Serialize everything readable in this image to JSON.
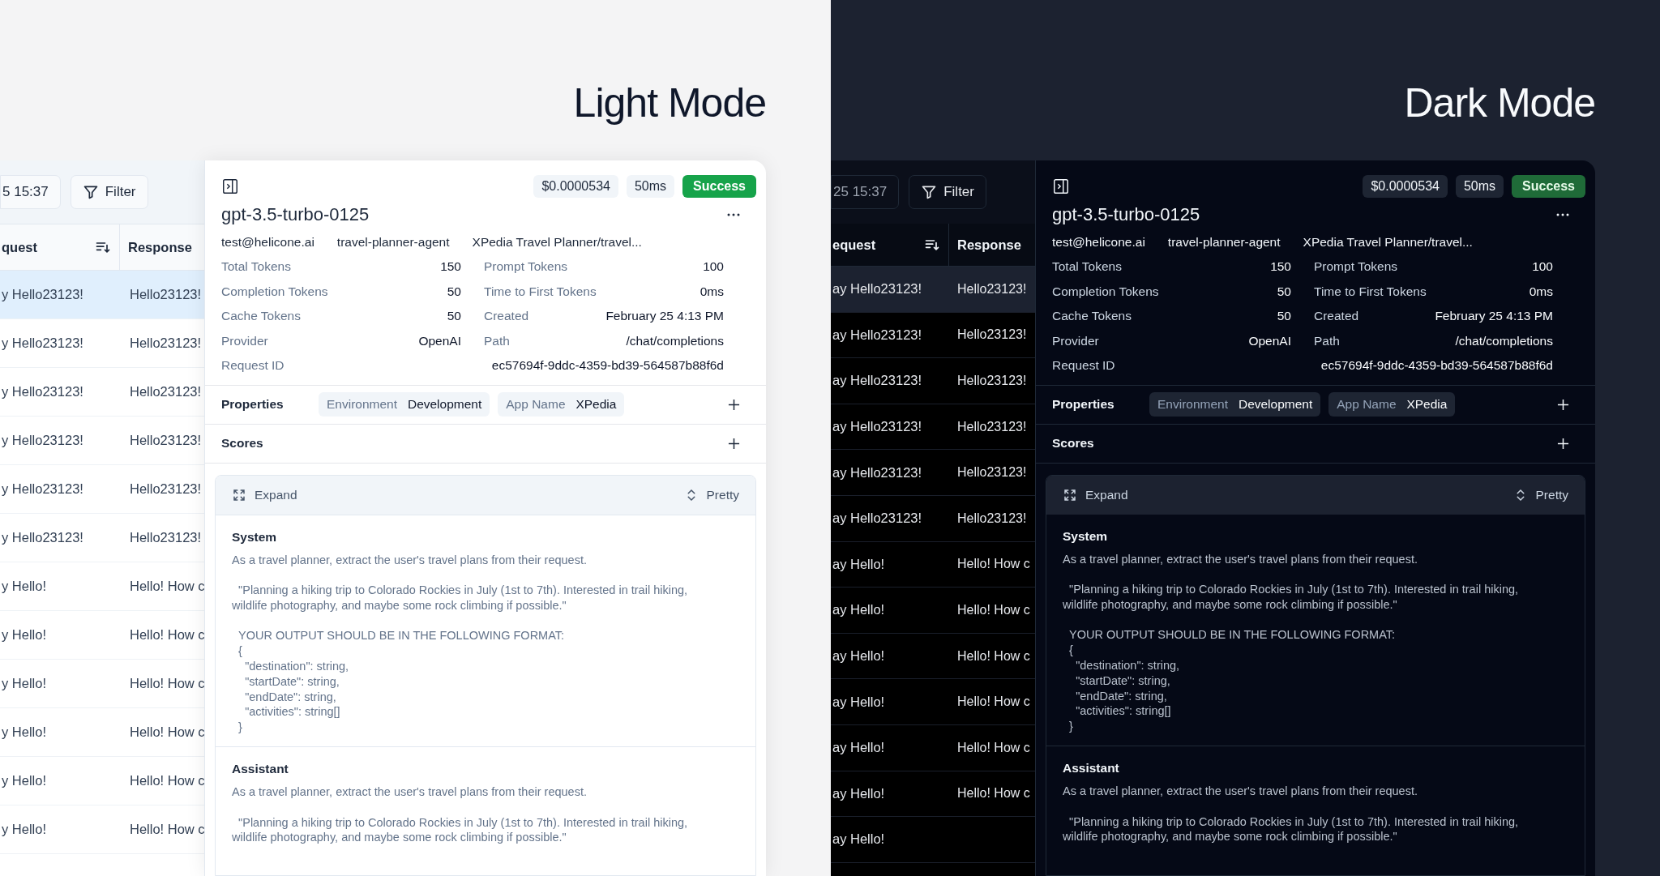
{
  "modes": [
    {
      "kind": "light",
      "heading": "Light Mode",
      "toolbar": {
        "date": "5 15:37",
        "filter": "Filter"
      },
      "table": {
        "columns": [
          "quest",
          "Response"
        ],
        "rows": [
          {
            "request": "y Hello23123!",
            "response": "Hello23123!",
            "selected": true
          },
          {
            "request": "y Hello23123!",
            "response": "Hello23123!",
            "selected": false
          },
          {
            "request": "y Hello23123!",
            "response": "Hello23123!",
            "selected": false
          },
          {
            "request": "y Hello23123!",
            "response": "Hello23123!",
            "selected": false
          },
          {
            "request": "y Hello23123!",
            "response": "Hello23123!",
            "selected": false
          },
          {
            "request": "y Hello23123!",
            "response": "Hello23123!",
            "selected": false
          },
          {
            "request": "y Hello!",
            "response": "Hello! How c",
            "selected": false
          },
          {
            "request": "y Hello!",
            "response": "Hello! How c",
            "selected": false
          },
          {
            "request": "y Hello!",
            "response": "Hello! How c",
            "selected": false
          },
          {
            "request": "y Hello!",
            "response": "Hello! How c",
            "selected": false
          },
          {
            "request": "y Hello!",
            "response": "Hello! How c",
            "selected": false
          },
          {
            "request": "y Hello!",
            "response": "Hello! How c",
            "selected": false
          }
        ]
      },
      "detail": {
        "cost": "$0.0000534",
        "latency": "50ms",
        "status": {
          "label": "Success",
          "kind": "success"
        },
        "model": "gpt-3.5-turbo-0125",
        "meta": [
          "test@helicone.ai",
          "travel-planner-agent",
          "XPedia Travel Planner/travel..."
        ],
        "stats": [
          {
            "label": "Total Tokens",
            "value": "150"
          },
          {
            "label": "Prompt Tokens",
            "value": "100"
          },
          {
            "label": "Completion Tokens",
            "value": "50"
          },
          {
            "label": "Time to First Tokens",
            "value": "0ms"
          },
          {
            "label": "Cache Tokens",
            "value": "50"
          },
          {
            "label": "Created",
            "value": "February 25 4:13 PM"
          },
          {
            "label": "Provider",
            "value": "OpenAI"
          },
          {
            "label": "Path",
            "value": "/chat/completions"
          }
        ],
        "request_id": {
          "label": "Request ID",
          "value": "ec57694f-9ddc-4359-bd39-564587b88f6d"
        },
        "properties": {
          "label": "Properties",
          "items": [
            {
              "key": "Environment",
              "value": "Development"
            },
            {
              "key": "App Name",
              "value": "XPedia"
            }
          ]
        },
        "scores": {
          "label": "Scores"
        },
        "viewer": {
          "expand": "Expand",
          "format": "Pretty",
          "messages": [
            {
              "role": "System",
              "text": "As a travel planner, extract the user's travel plans from their request.\n\n  \"Planning a hiking trip to Colorado Rockies in July (1st to 7th). Interested in trail hiking,\nwildlife photography, and maybe some rock climbing if possible.\"\n\n  YOUR OUTPUT SHOULD BE IN THE FOLLOWING FORMAT:\n  {\n    \"destination\": string,\n    \"startDate\": string,\n    \"endDate\": string,\n    \"activities\": string[]\n  }"
            },
            {
              "role": "Assistant",
              "text": "As a travel planner, extract the user's travel plans from their request.\n\n  \"Planning a hiking trip to Colorado Rockies in July (1st to 7th). Interested in trail hiking,\nwildlife photography, and maybe some rock climbing if possible.\""
            }
          ]
        }
      }
    },
    {
      "kind": "dark",
      "heading": "Dark Mode",
      "toolbar": {
        "date": "25 15:37",
        "filter": "Filter"
      },
      "table": {
        "columns": [
          "equest",
          "Response"
        ],
        "rows": [
          {
            "request": "ay Hello23123!",
            "response": "Hello23123!",
            "selected": true
          },
          {
            "request": "ay Hello23123!",
            "response": "Hello23123!",
            "selected": false
          },
          {
            "request": "ay Hello23123!",
            "response": "Hello23123!",
            "selected": false
          },
          {
            "request": "ay Hello23123!",
            "response": "Hello23123!",
            "selected": false
          },
          {
            "request": "ay Hello23123!",
            "response": "Hello23123!",
            "selected": false
          },
          {
            "request": "ay Hello23123!",
            "response": "Hello23123!",
            "selected": false
          },
          {
            "request": "ay Hello!",
            "response": "Hello! How c",
            "selected": false
          },
          {
            "request": "ay Hello!",
            "response": "Hello! How c",
            "selected": false
          },
          {
            "request": "ay Hello!",
            "response": "Hello! How c",
            "selected": false
          },
          {
            "request": "ay Hello!",
            "response": "Hello! How c",
            "selected": false
          },
          {
            "request": "ay Hello!",
            "response": "Hello! How c",
            "selected": false
          },
          {
            "request": "ay Hello!",
            "response": "Hello! How c",
            "selected": false
          },
          {
            "request": "ay Hello!",
            "selected": false
          }
        ]
      },
      "detail": {
        "cost": "$0.0000534",
        "latency": "50ms",
        "status": {
          "label": "Success",
          "kind": "success"
        },
        "model": "gpt-3.5-turbo-0125",
        "meta": [
          "test@helicone.ai",
          "travel-planner-agent",
          "XPedia Travel Planner/travel..."
        ],
        "stats": [
          {
            "label": "Total Tokens",
            "value": "150"
          },
          {
            "label": "Prompt Tokens",
            "value": "100"
          },
          {
            "label": "Completion Tokens",
            "value": "50"
          },
          {
            "label": "Time to First Tokens",
            "value": "0ms"
          },
          {
            "label": "Cache Tokens",
            "value": "50"
          },
          {
            "label": "Created",
            "value": "February 25 4:13 PM"
          },
          {
            "label": "Provider",
            "value": "OpenAI"
          },
          {
            "label": "Path",
            "value": "/chat/completions"
          }
        ],
        "request_id": {
          "label": "Request ID",
          "value": "ec57694f-9ddc-4359-bd39-564587b88f6d"
        },
        "properties": {
          "label": "Properties",
          "items": [
            {
              "key": "Environment",
              "value": "Development"
            },
            {
              "key": "App Name",
              "value": "XPedia"
            }
          ]
        },
        "scores": {
          "label": "Scores"
        },
        "viewer": {
          "expand": "Expand",
          "format": "Pretty",
          "messages": [
            {
              "role": "System",
              "text": "As a travel planner, extract the user's travel plans from their request.\n\n  \"Planning a hiking trip to Colorado Rockies in July (1st to 7th). Interested in trail hiking,\nwildlife photography, and maybe some rock climbing if possible.\"\n\n  YOUR OUTPUT SHOULD BE IN THE FOLLOWING FORMAT:\n  {\n    \"destination\": string,\n    \"startDate\": string,\n    \"endDate\": string,\n    \"activities\": string[]\n  }"
            },
            {
              "role": "Assistant",
              "text": "As a travel planner, extract the user's travel plans from their request.\n\n  \"Planning a hiking trip to Colorado Rockies in July (1st to 7th). Interested in trail hiking,\nwildlife photography, and maybe some rock climbing if possible.\""
            }
          ]
        }
      }
    }
  ]
}
